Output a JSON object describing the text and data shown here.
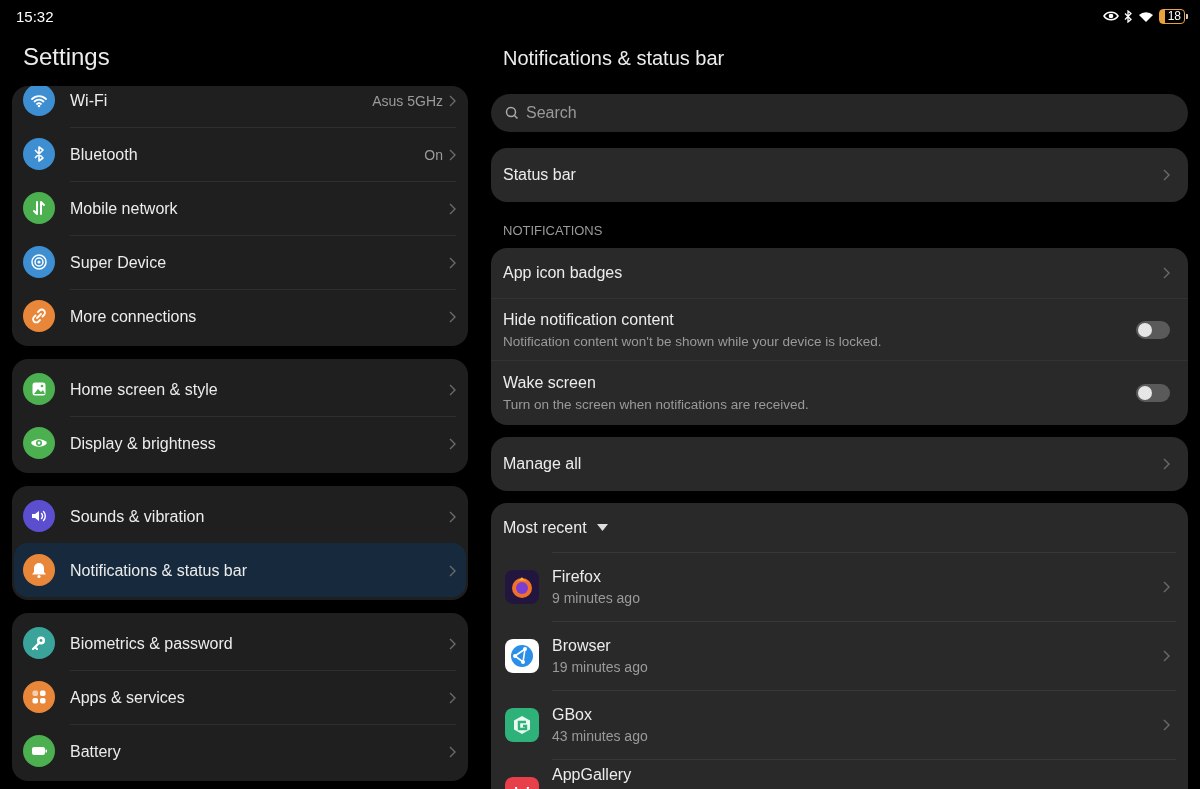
{
  "status_bar": {
    "time": "15:32",
    "battery": "18"
  },
  "sidebar": {
    "title": "Settings",
    "groups": [
      [
        {
          "label": "Wi-Fi",
          "value": "Asus 5GHz",
          "kind": "wifi",
          "color": "#3d8fd1",
          "selected": false
        },
        {
          "label": "Bluetooth",
          "value": "On",
          "kind": "bluetooth",
          "color": "#3d8fd1",
          "selected": false
        },
        {
          "label": "Mobile network",
          "kind": "mobile",
          "color": "#4caf50",
          "selected": false
        },
        {
          "label": "Super Device",
          "kind": "super",
          "color": "#3d8fd1",
          "selected": false
        },
        {
          "label": "More connections",
          "kind": "link",
          "color": "#e8873a",
          "selected": false
        }
      ],
      [
        {
          "label": "Home screen & style",
          "kind": "image",
          "color": "#4caf50",
          "selected": false
        },
        {
          "label": "Display & brightness",
          "kind": "eye",
          "color": "#4caf50",
          "selected": false
        }
      ],
      [
        {
          "label": "Sounds & vibration",
          "kind": "sound",
          "color": "#5b4fcf",
          "selected": false
        },
        {
          "label": "Notifications & status bar",
          "kind": "bell",
          "color": "#e8873a",
          "selected": true
        }
      ],
      [
        {
          "label": "Biometrics & password",
          "kind": "key",
          "color": "#3aa39a",
          "selected": false
        },
        {
          "label": "Apps & services",
          "kind": "apps",
          "color": "#e8873a",
          "selected": false
        },
        {
          "label": "Battery",
          "kind": "battery",
          "color": "#4caf50",
          "selected": false
        }
      ]
    ]
  },
  "detail": {
    "title": "Notifications & status bar",
    "search": {
      "placeholder": "Search"
    },
    "status_row": {
      "label": "Status bar"
    },
    "section": "NOTIFICATIONS",
    "settings": [
      {
        "kind": "link",
        "label": "App icon badges"
      },
      {
        "kind": "toggle",
        "label": "Hide notification content",
        "description": "Notification content won't be shown while your device is locked.",
        "on": false
      },
      {
        "kind": "toggle",
        "label": "Wake screen",
        "description": "Turn on the screen when notifications are received.",
        "on": false
      }
    ],
    "manage": {
      "label": "Manage all"
    },
    "recent": {
      "sort": "Most recent",
      "apps": [
        {
          "name": "Firefox",
          "time": "9 minutes ago",
          "kind": "firefox"
        },
        {
          "name": "Browser",
          "time": "19 minutes ago",
          "kind": "browser"
        },
        {
          "name": "GBox",
          "time": "43 minutes ago",
          "kind": "gbox"
        },
        {
          "name": "AppGallery",
          "kind": "appgallery"
        }
      ]
    }
  }
}
